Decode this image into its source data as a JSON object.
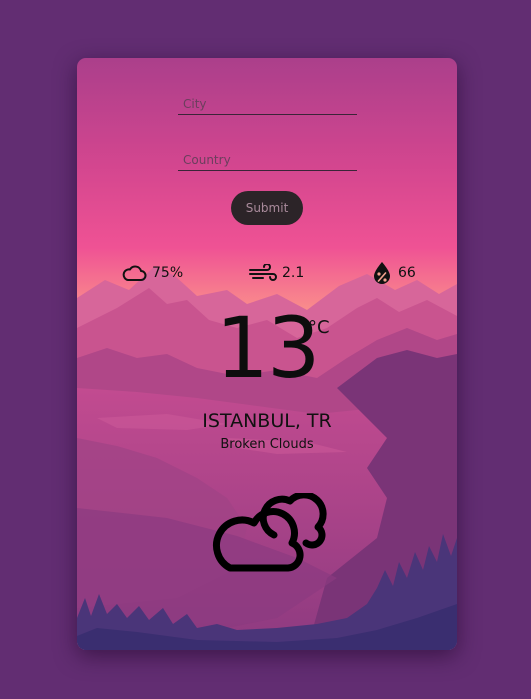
{
  "form": {
    "city_placeholder": "City",
    "country_placeholder": "Country",
    "submit_label": "Submit"
  },
  "stats": {
    "cloudiness": "75%",
    "wind": "2.1",
    "humidity": "66"
  },
  "weather": {
    "temperature": "13",
    "unit": "°C",
    "location": "ISTANBUL, TR",
    "description": "Broken Clouds",
    "icon": "broken-clouds-icon"
  },
  "colors": {
    "page_background": "#622d72",
    "sky_top": "#a93f8a",
    "sky_pink": "#e8468f",
    "horizon": "#f9b08d",
    "mountains_far": "#c4518f",
    "mountains_mid": "#9a3e7e",
    "forest": "#3f3477",
    "button_bg": "#2c2428"
  }
}
